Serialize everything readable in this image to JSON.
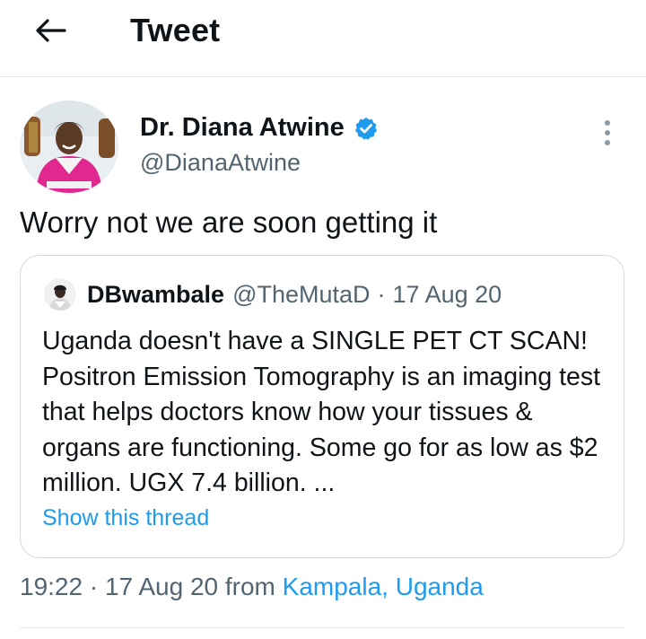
{
  "header": {
    "title": "Tweet",
    "back_icon": "arrow-left-icon"
  },
  "tweet": {
    "author": {
      "display_name": "Dr. Diana Atwine",
      "handle": "@DianaAtwine",
      "verified": true,
      "verified_color": "#1d9bf0"
    },
    "text": "Worry not we are soon getting it",
    "quoted": {
      "display_name": "DBwambale",
      "handle": "@TheMutaD",
      "separator": "·",
      "date": "17 Aug 20",
      "text": "Uganda doesn't have a SINGLE PET CT SCAN! Positron Emission Tomography is an imaging test that helps doctors know how your tissues & organs are functioning. Some go for as low as $2 million. UGX 7.4 billion. ...",
      "show_thread": "Show this thread"
    },
    "meta": {
      "time": "19:22",
      "separator": "·",
      "date": "17 Aug 20",
      "from": "from",
      "location": "Kampala, Uganda"
    }
  },
  "colors": {
    "link": "#1d9bf0",
    "secondary_text": "#536471",
    "border": "#cfd9de"
  }
}
